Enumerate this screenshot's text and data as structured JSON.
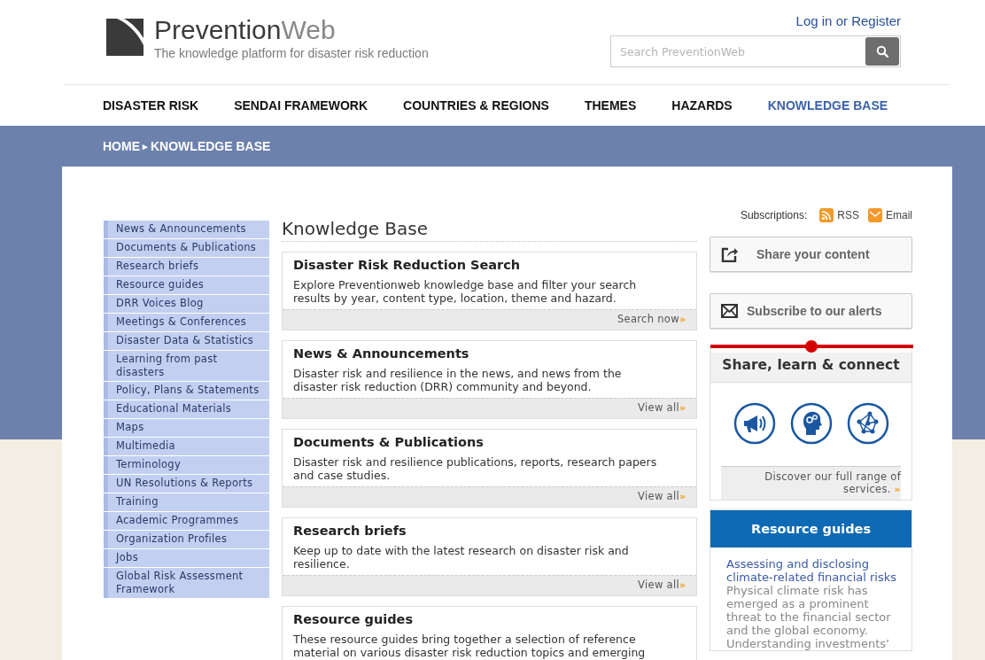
{
  "header": {
    "logo": {
      "name_main": "Prevention",
      "name_accent": "Web",
      "tagline": "The knowledge platform for disaster risk reduction"
    },
    "login_link": "Log in or Register",
    "search": {
      "placeholder": "Search PreventionWeb"
    }
  },
  "nav": [
    {
      "label": "DISASTER RISK",
      "selected": false
    },
    {
      "label": "SENDAI FRAMEWORK",
      "selected": false
    },
    {
      "label": "COUNTRIES & REGIONS",
      "selected": false
    },
    {
      "label": "THEMES",
      "selected": false
    },
    {
      "label": "HAZARDS",
      "selected": false
    },
    {
      "label": "KNOWLEDGE BASE",
      "selected": true
    }
  ],
  "breadcrumb": {
    "items": [
      "HOME",
      "KNOWLEDGE BASE"
    ],
    "separator": "▸"
  },
  "sidebar": {
    "items": [
      "News & Announcements",
      "Documents & Publications",
      "Research briefs",
      "Resource guides",
      "DRR Voices Blog",
      "Meetings & Conferences",
      "Disaster Data & Statistics",
      "Learning from past disasters",
      "Policy, Plans & Statements",
      "Educational Materials",
      "Maps",
      "Multimedia",
      "Terminology",
      "UN Resolutions & Reports",
      "Training",
      "Academic Programmes",
      "Organization Profiles",
      "Jobs",
      "Global Risk Assessment Framework"
    ]
  },
  "main": {
    "title": "Knowledge Base",
    "cards": [
      {
        "title": "Disaster Risk Reduction Search",
        "description": "Explore Preventionweb knowledge base and filter your search results by year, content type, location, theme and hazard.",
        "link": "Search now",
        "arrow": "»"
      },
      {
        "title": "News & Announcements",
        "description": "Disaster risk and resilience in the news, and news from the disaster risk reduction (DRR) community and beyond.",
        "link": "View all",
        "arrow": "»"
      },
      {
        "title": "Documents & Publications",
        "description": "Disaster risk and resilience publications, reports, research papers and case studies.",
        "link": "View all",
        "arrow": "»"
      },
      {
        "title": "Research briefs",
        "description": "Keep up to date with the latest research on disaster risk and resilience.",
        "link": "View all",
        "arrow": "»"
      },
      {
        "title": "Resource guides",
        "description": "These resource guides bring together a selection of reference material on various disaster risk reduction topics and emerging"
      }
    ]
  },
  "right": {
    "subscriptions": {
      "label": "Subscriptions:",
      "links": [
        {
          "kind": "rss",
          "label": "RSS"
        },
        {
          "kind": "email",
          "label": "Email"
        }
      ]
    },
    "buttons": [
      {
        "kind": "share",
        "label": "Share your content"
      },
      {
        "kind": "alerts",
        "label": "Subscribe to our alerts"
      }
    ],
    "connect": {
      "title": "Share, learn & connect",
      "icons": [
        {
          "kind": "megaphone"
        },
        {
          "kind": "head"
        },
        {
          "kind": "network"
        }
      ],
      "link": "Discover our full range of services.",
      "arrow": "»"
    },
    "resource_guides": {
      "title": "Resource guides",
      "item_title": "Assessing and disclosing climate-related financial risks",
      "item_text": "Physical climate risk has emerged as a prominent threat to the financial sector and the global economy. Understanding investments’"
    }
  }
}
